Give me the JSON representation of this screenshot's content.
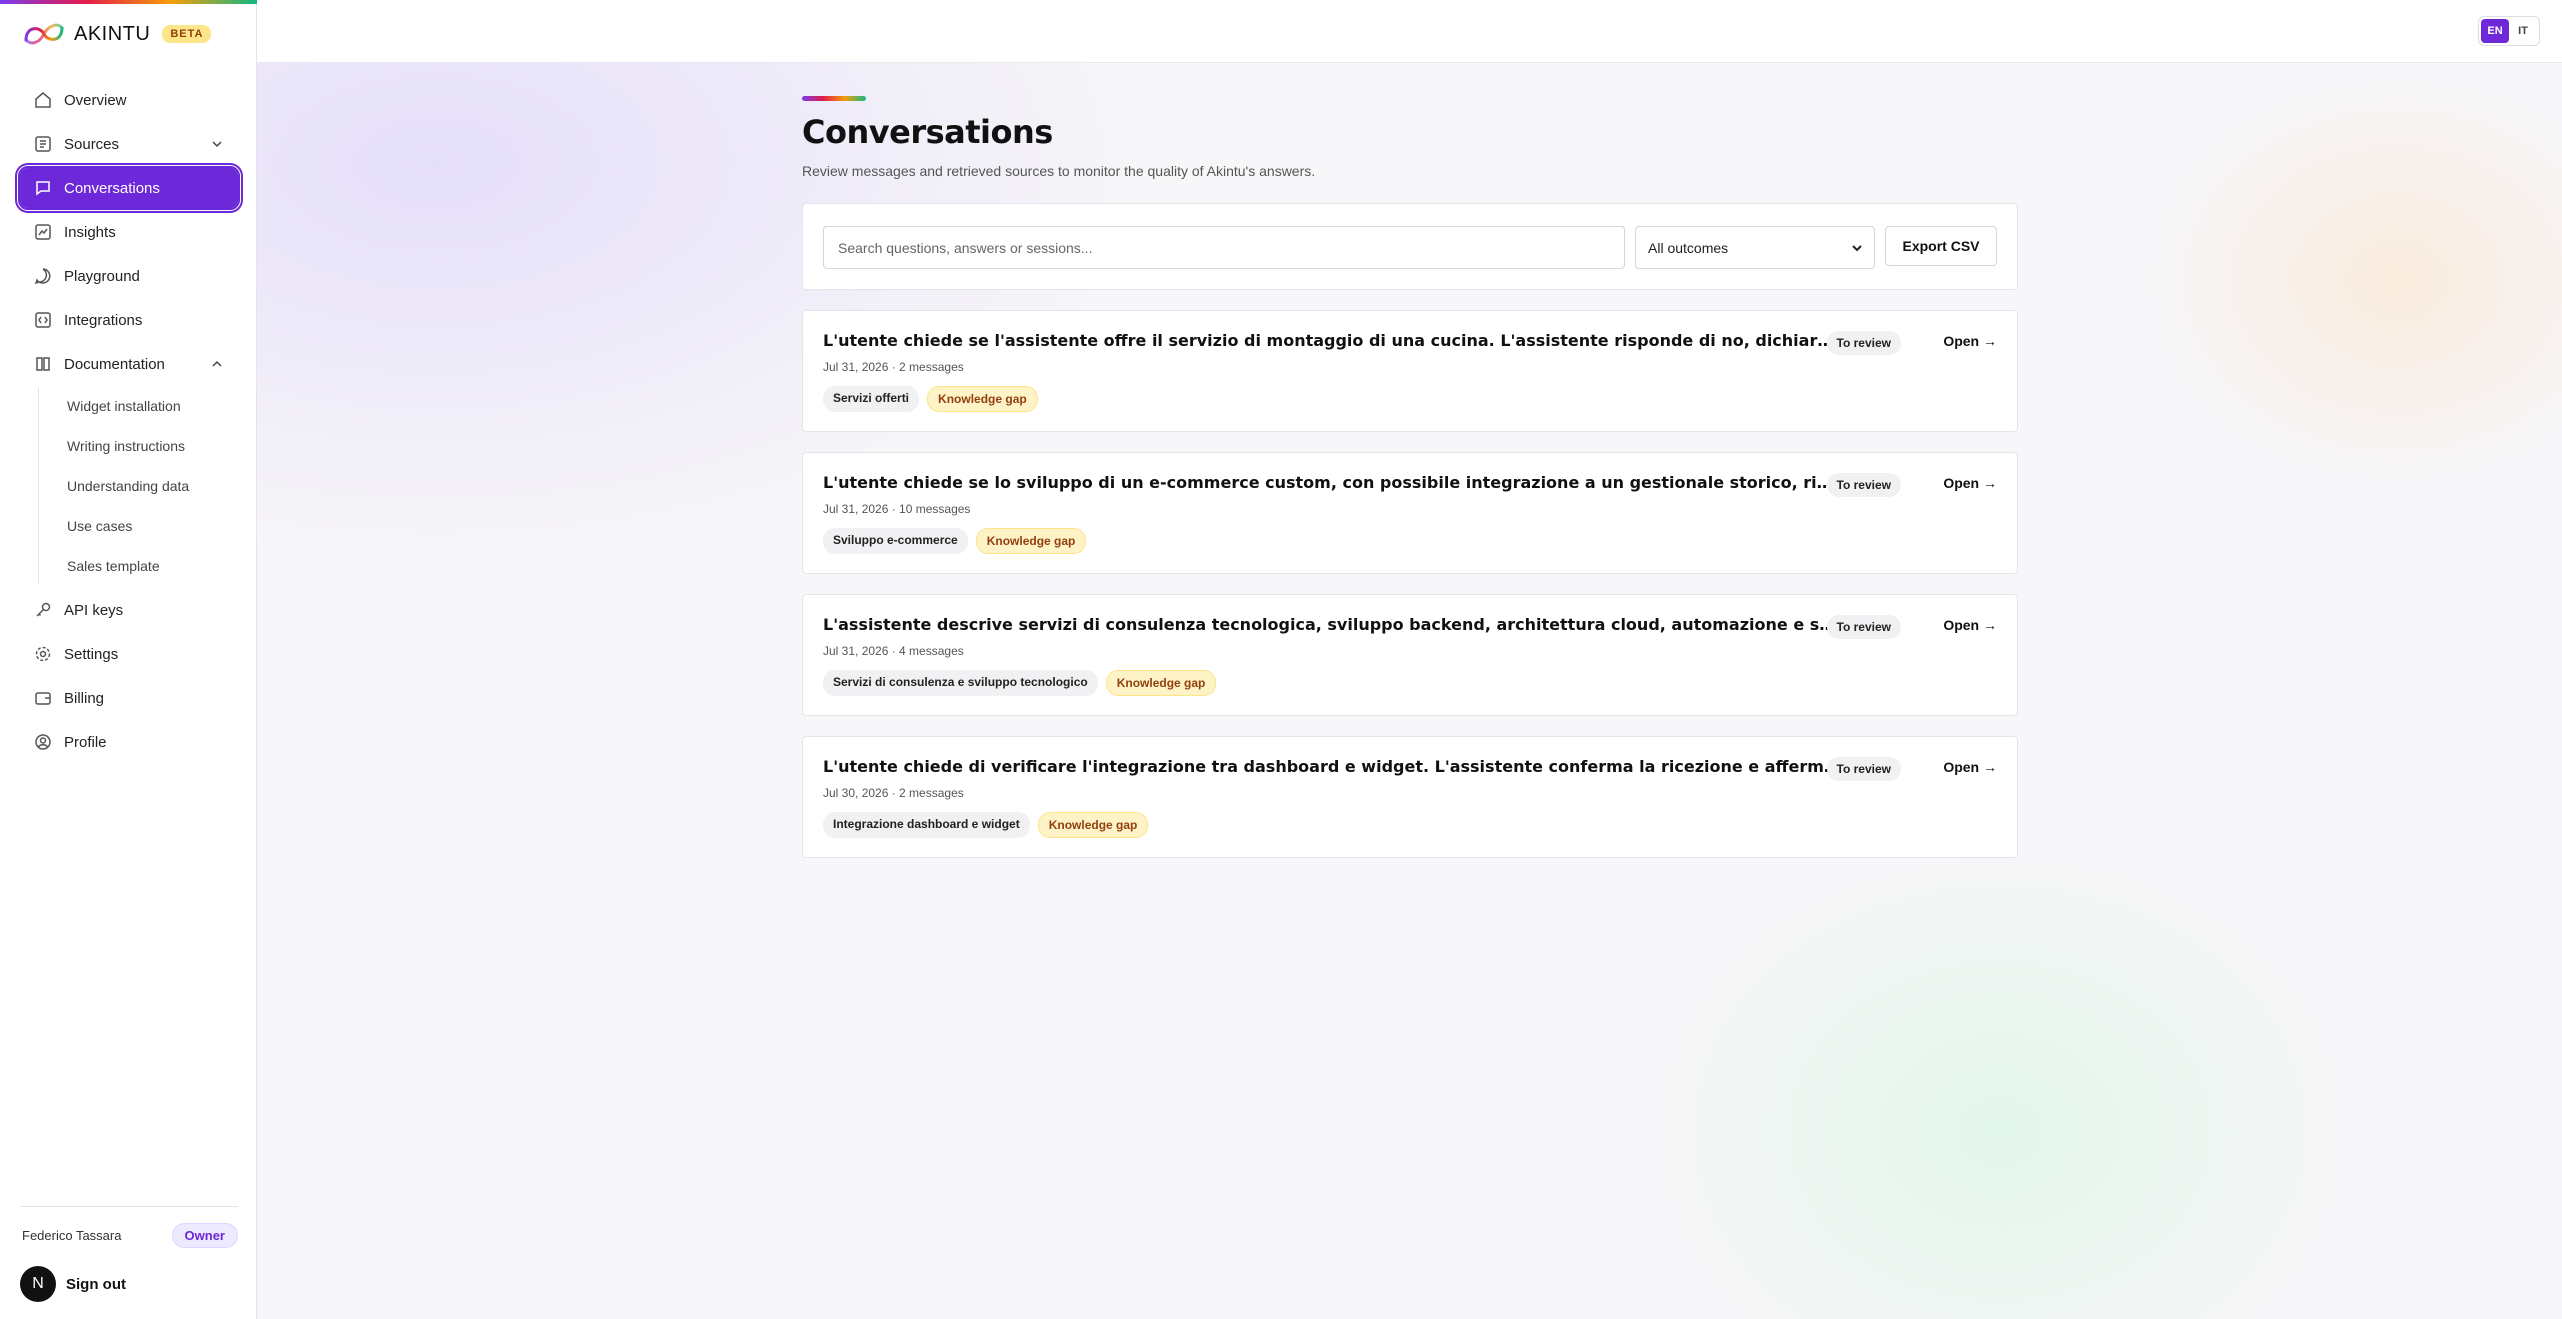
{
  "brand": {
    "name": "AKINTU",
    "badge": "BETA"
  },
  "sidebar": {
    "items": [
      {
        "label": "Overview",
        "icon": "home-icon"
      },
      {
        "label": "Sources",
        "icon": "database-icon"
      },
      {
        "label": "Conversations",
        "icon": "chat-icon"
      },
      {
        "label": "Insights",
        "icon": "chart-icon"
      },
      {
        "label": "Playground",
        "icon": "message-circle-icon"
      },
      {
        "label": "Integrations",
        "icon": "code-icon"
      },
      {
        "label": "Documentation",
        "icon": "book-icon"
      },
      {
        "label": "API keys",
        "icon": "key-icon"
      },
      {
        "label": "Settings",
        "icon": "gear-icon"
      },
      {
        "label": "Billing",
        "icon": "wallet-icon"
      },
      {
        "label": "Profile",
        "icon": "user-icon"
      }
    ],
    "docs_sub": [
      "Widget installation",
      "Writing instructions",
      "Understanding data",
      "Use cases",
      "Sales template"
    ],
    "user": {
      "name": "Federico Tassara",
      "role": "Owner",
      "initial": "N",
      "signout": "Sign out"
    }
  },
  "topbar": {
    "lang_en": "EN",
    "lang_it": "IT"
  },
  "page": {
    "title": "Conversations",
    "subtitle": "Review messages and retrieved sources to monitor the quality of Akintu's answers."
  },
  "filters": {
    "search_placeholder": "Search questions, answers or sessions...",
    "outcome_selected": "All outcomes",
    "export_label": "Export CSV"
  },
  "conversations": [
    {
      "title": "L'utente chiede se l'assistente offre il servizio di montaggio di una cucina. L'assistente risponde di no, dichiarando di non poter aiutare.",
      "meta": "Jul 31, 2026 · 2 messages",
      "topic": "Servizi offerti",
      "gap": "Knowledge gap",
      "status": "To review",
      "open": "Open →"
    },
    {
      "title": "L'utente chiede se lo sviluppo di un e-commerce custom, con possibile integrazione a un gestionale storico, rientri nei servizi offerti.",
      "meta": "Jul 31, 2026 · 10 messages",
      "topic": "Sviluppo e-commerce",
      "gap": "Knowledge gap",
      "status": "To review",
      "open": "Open →"
    },
    {
      "title": "L'assistente descrive servizi di consulenza tecnologica, sviluppo backend, architettura cloud, automazione e supporto tecnico.",
      "meta": "Jul 31, 2026 · 4 messages",
      "topic": "Servizi di consulenza e sviluppo tecnologico",
      "gap": "Knowledge gap",
      "status": "To review",
      "open": "Open →"
    },
    {
      "title": "L'utente chiede di verificare l'integrazione tra dashboard e widget. L'assistente conferma la ricezione e afferma che funziona correttamente.",
      "meta": "Jul 30, 2026 · 2 messages",
      "topic": "Integrazione dashboard e widget",
      "gap": "Knowledge gap",
      "status": "To review",
      "open": "Open →"
    }
  ]
}
